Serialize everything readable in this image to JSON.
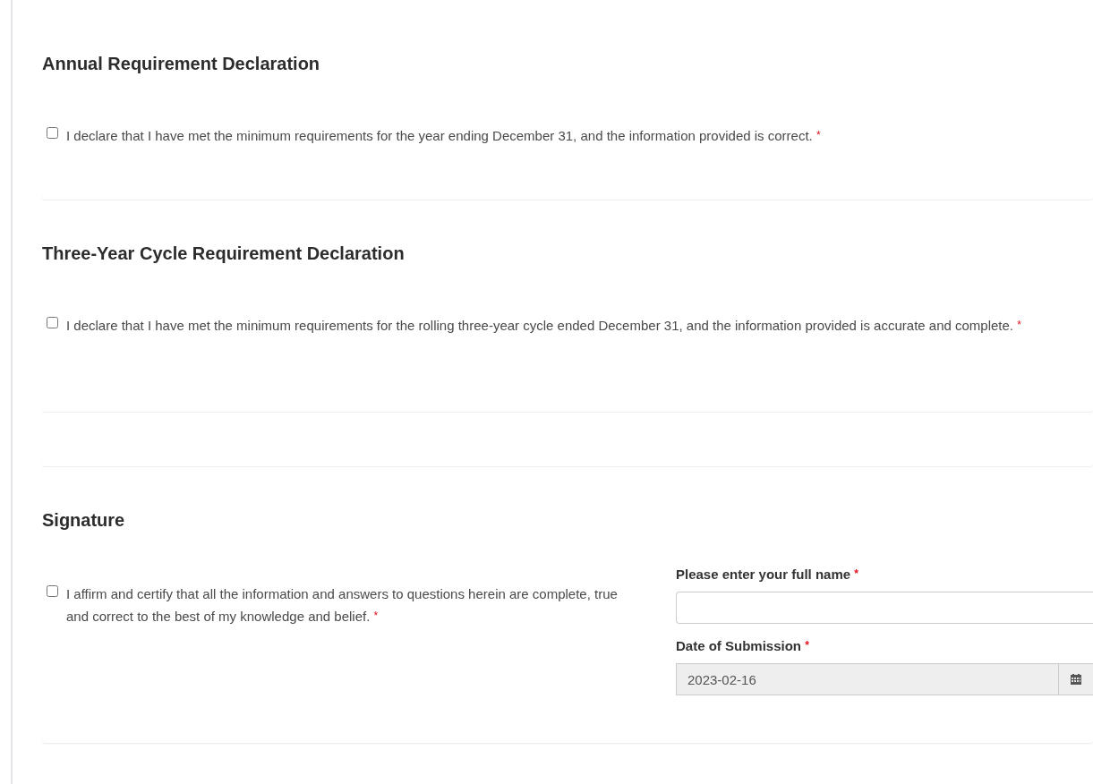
{
  "sections": [
    {
      "kind": "declaration",
      "title": "Annual Requirement Declaration",
      "checkbox": {
        "label": "I declare that I have met the minimum requirements for the year ending December 31, and the information provided is correct.",
        "required_mark": "*",
        "checked": false
      }
    },
    {
      "kind": "declaration",
      "title": "Three-Year Cycle Requirement Declaration",
      "checkbox": {
        "label": "I declare that I have met the minimum requirements for the rolling three-year cycle ended December 31, and the information provided is accurate and complete.",
        "required_mark": "*",
        "checked": false
      }
    },
    {
      "kind": "empty"
    },
    {
      "kind": "signature",
      "title": "Signature",
      "checkbox": {
        "label": "I affirm and certify that all the information and answers to questions herein are complete, true and correct to the best of my knowledge and belief.",
        "required_mark": "*",
        "checked": false
      },
      "name_field": {
        "label": "Please enter your full name",
        "required_mark": "*"
      },
      "date_field": {
        "label": "Date of Submission",
        "required_mark": "*",
        "value": "2023-02-16"
      }
    }
  ]
}
